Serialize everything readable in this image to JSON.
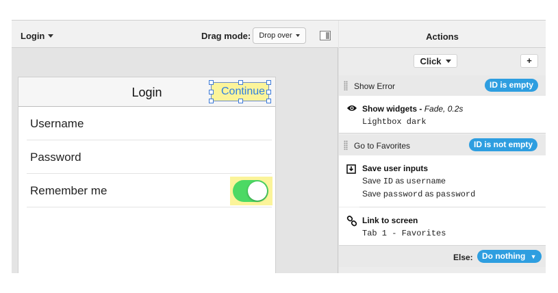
{
  "editor": {
    "screen_selector": "Login",
    "drag_mode_label": "Drag mode:",
    "drag_mode_value": "Drop over"
  },
  "phone": {
    "nav_title": "Login",
    "continue_button": "Continue",
    "rows": [
      {
        "label": "Username"
      },
      {
        "label": "Password"
      },
      {
        "label": "Remember me"
      }
    ],
    "remember_toggle_on": true,
    "toggle_color": "#4cd964"
  },
  "actions_panel": {
    "title": "Actions",
    "trigger": "Click",
    "add_button": "+",
    "conditions": [
      {
        "label": "Show Error",
        "badge": "ID is empty",
        "action": {
          "icon": "eye-icon",
          "title": "Show widgets",
          "detail": "Fade, 0.2s",
          "lines": [
            "Lightbox dark"
          ]
        }
      },
      {
        "label": "Go to Favorites",
        "badge": "ID is not empty",
        "actions": [
          {
            "icon": "save-icon",
            "title": "Save user inputs",
            "lines": [
              {
                "prefix": "Save",
                "from": "ID",
                "as": "as",
                "to": "username"
              },
              {
                "prefix": "Save",
                "from": "password",
                "as": "as",
                "to": "password"
              }
            ]
          },
          {
            "icon": "link-icon",
            "title": "Link to screen",
            "lines": [
              "Tab 1 - Favorites"
            ]
          }
        ]
      }
    ],
    "else_label": "Else:",
    "else_value": "Do nothing",
    "badge_color": "#2e9ee0"
  }
}
